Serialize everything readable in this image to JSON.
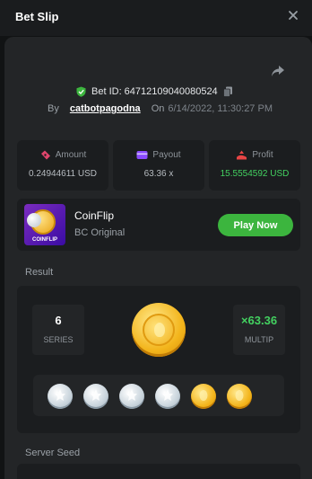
{
  "header": {
    "title": "Bet Slip"
  },
  "bet": {
    "id_text": "Bet ID: 64712109040080524",
    "by_label": "By",
    "user": "catbotpagodna",
    "on_label": "On",
    "date": "6/14/2022, 11:30:27 PM"
  },
  "stats": {
    "amount": {
      "label": "Amount",
      "value": "0.24944611 USD"
    },
    "payout": {
      "label": "Payout",
      "value": "63.36 x"
    },
    "profit": {
      "label": "Profit",
      "value": "15.5554592 USD"
    }
  },
  "game": {
    "name": "CoinFlip",
    "subtitle": "BC Original",
    "thumb_label": "COINFLIP",
    "play_label": "Play Now"
  },
  "result": {
    "label": "Result",
    "series_value": "6",
    "series_label": "SERIES",
    "multip_value": "×63.36",
    "multip_label": "MULTIP",
    "flips": [
      "silver",
      "silver",
      "silver",
      "silver",
      "gold",
      "gold"
    ]
  },
  "server_seed": {
    "label": "Server Seed"
  },
  "colors": {
    "accent_green": "#3cb53e",
    "profit_green": "#43d160",
    "background": "#111314",
    "panel": "#232527",
    "card": "#1b1d1f"
  },
  "icons": {
    "close": "close-icon",
    "share": "share-icon",
    "shield": "shield-check-icon",
    "copy": "copy-icon",
    "amount": "ticket-icon",
    "payout": "wallet-icon",
    "profit": "profit-icon"
  }
}
